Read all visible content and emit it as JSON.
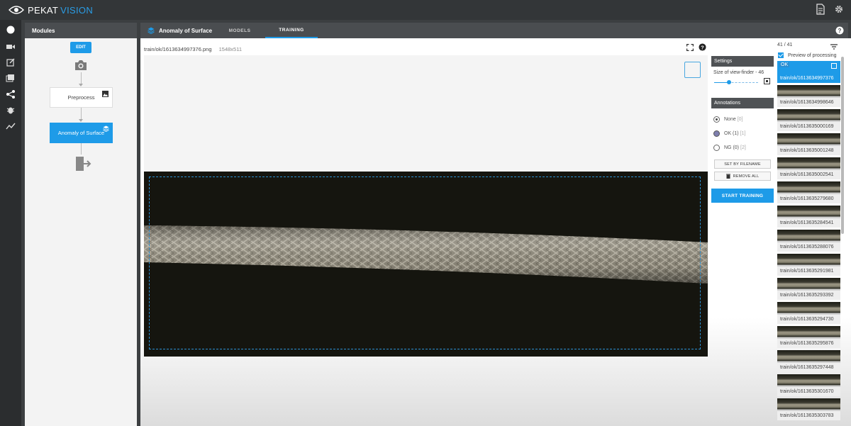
{
  "app": {
    "brand_left": "PEKAT",
    "brand_right": "VISION"
  },
  "modules": {
    "header": "Modules",
    "edit_label": "EDIT",
    "nodes": [
      "Preprocess",
      "Anomaly of Surface"
    ]
  },
  "main": {
    "title": "Anomaly of Surface",
    "tabs": [
      "MODELS",
      "TRAINING"
    ],
    "active_tab": "TRAINING",
    "image_path": "train/ok/1613634997376.png",
    "image_size": "1548x511"
  },
  "settings": {
    "header": "Settings",
    "viewfinder_label": "Size of view-finder - 46",
    "viewfinder_value": 46
  },
  "annotations": {
    "header": "Annotations",
    "options": [
      {
        "label": "None",
        "count": "[0]"
      },
      {
        "label": "OK (1)",
        "count": "[1]"
      },
      {
        "label": "NG (0)",
        "count": "[2]"
      }
    ],
    "selected": "OK (1)",
    "set_by_filename": "SET BY FILENAME",
    "remove_all": "REMOVE ALL"
  },
  "start_training": "START TRAINING",
  "thumbnails": {
    "count": "41 / 41",
    "preview_label": "Preview of processing",
    "selected_badge": "OK",
    "items": [
      "train/ok/1613634997376",
      "train/ok/1613634998646",
      "train/ok/1613635000169",
      "train/ok/1613635001248",
      "train/ok/1613635002541",
      "train/ok/1613635279680",
      "train/ok/1613635284541",
      "train/ok/1613635288076",
      "train/ok/1613635291981",
      "train/ok/1613635293392",
      "train/ok/1613635294730",
      "train/ok/1613635295876",
      "train/ok/1613635297448",
      "train/ok/1613635301670",
      "train/ok/1613635303783"
    ]
  },
  "colors": {
    "accent": "#1e9be8",
    "header": "#4a4d50",
    "topbar": "#333638"
  }
}
